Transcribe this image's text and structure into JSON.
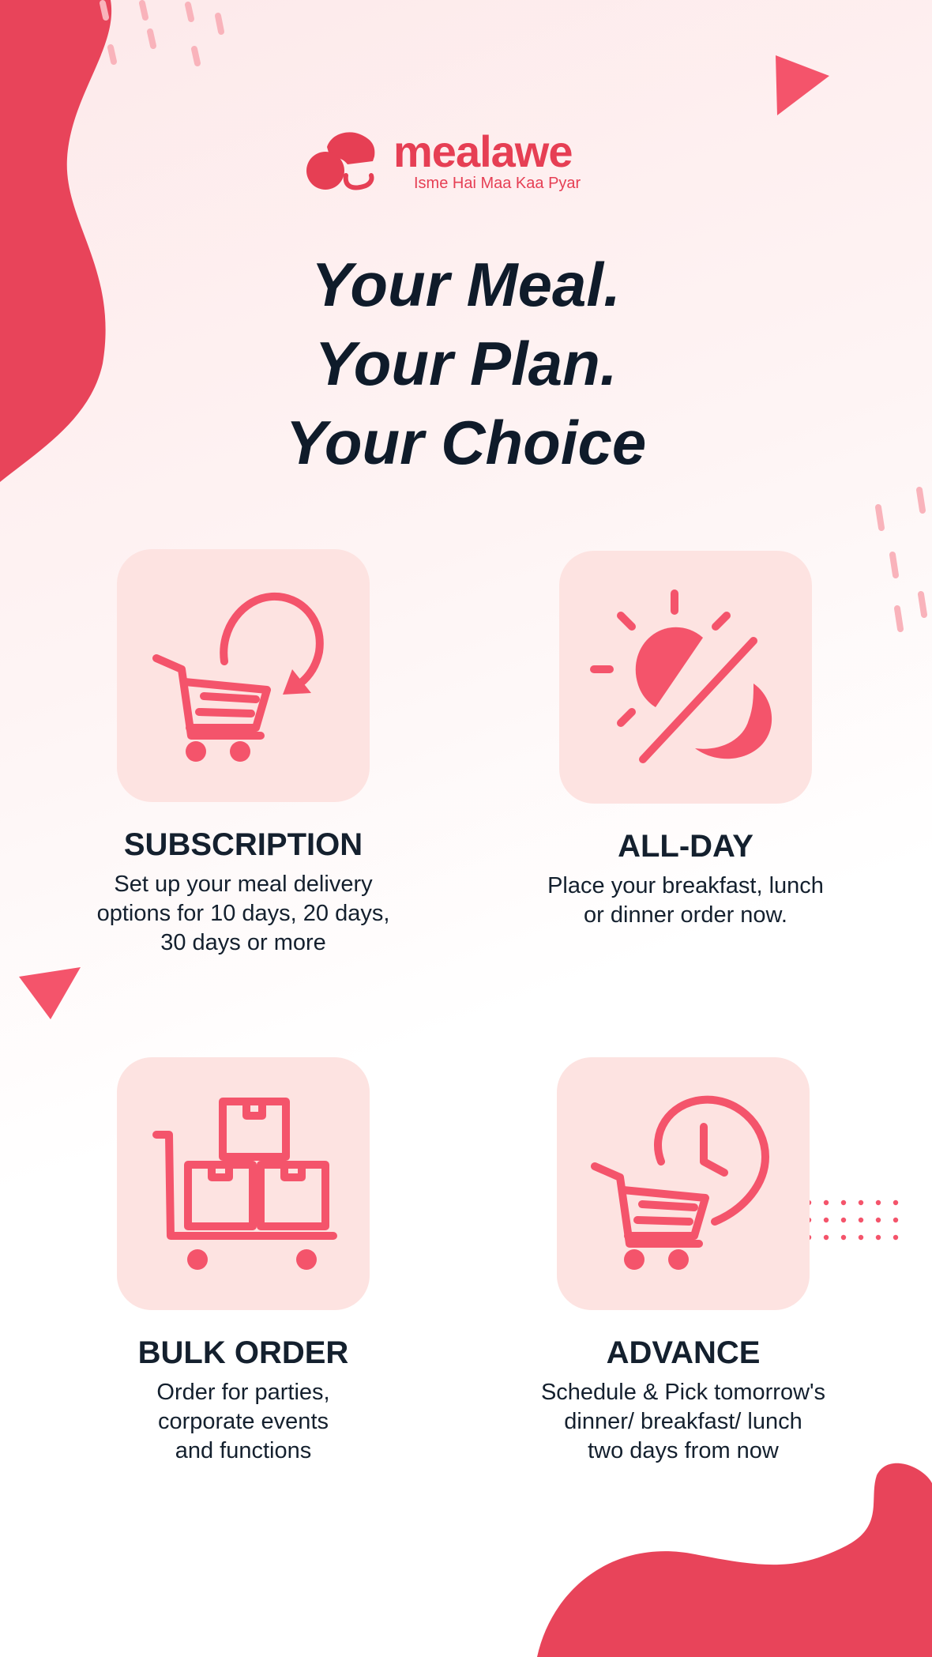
{
  "brand": {
    "name": "mealawe",
    "tagline": "Isme Hai Maa Kaa Pyar",
    "accent_color": "#e63f54",
    "icon_color": "#f4546b",
    "tile_color": "#fde3e1",
    "text_color": "#14202e"
  },
  "headline": {
    "line1": "Your Meal.",
    "line2": "Your Plan.",
    "line3": "Your Choice"
  },
  "features": [
    {
      "icon": "cart-refresh-icon",
      "title": "SUBSCRIPTION",
      "lines": [
        "Set up your meal delivery",
        "options for 10 days, 20 days,",
        "30 days or more"
      ]
    },
    {
      "icon": "sun-moon-icon",
      "title": "ALL-DAY",
      "lines": [
        "Place your breakfast, lunch",
        "or dinner order now."
      ]
    },
    {
      "icon": "boxes-trolley-icon",
      "title": "BULK ORDER",
      "lines": [
        "Order for parties,",
        "corporate events",
        "and functions"
      ]
    },
    {
      "icon": "cart-clock-icon",
      "title": "ADVANCE",
      "lines": [
        "Schedule & Pick tomorrow's",
        "dinner/ breakfast/ lunch",
        "two days from now"
      ]
    }
  ]
}
